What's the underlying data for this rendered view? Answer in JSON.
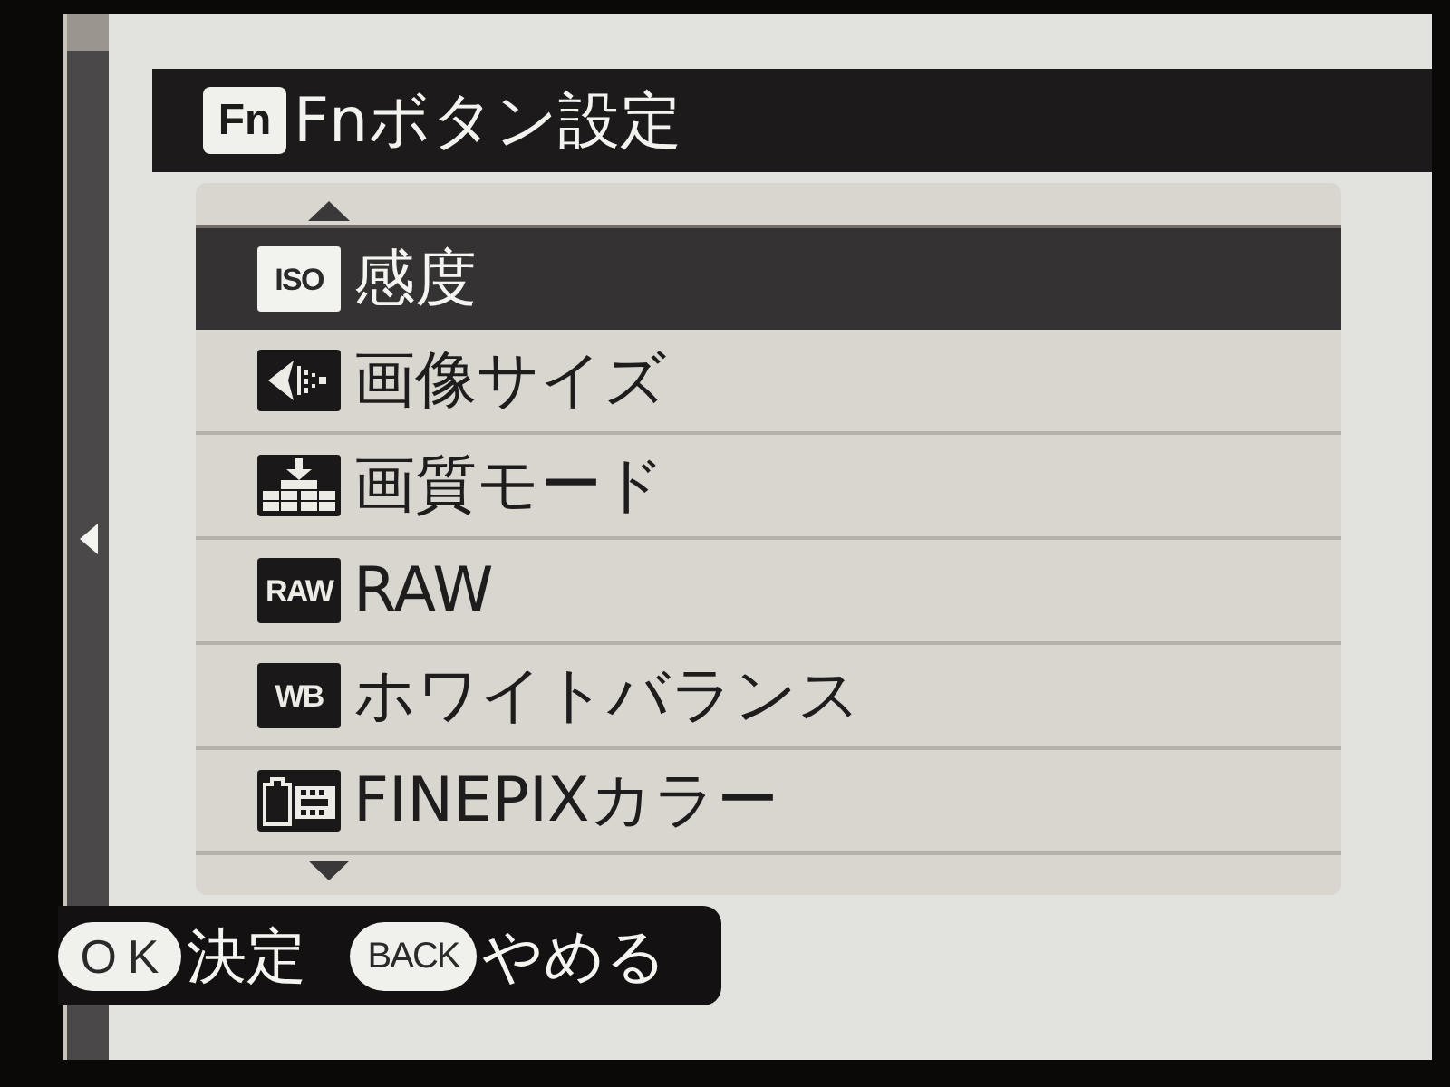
{
  "title": {
    "badge": "Fn",
    "text": "Fnボタン設定"
  },
  "menu": {
    "items": [
      {
        "kind": "badge",
        "badge": "ISO",
        "label": "感度",
        "selected": true
      },
      {
        "kind": "image_size",
        "label": "画像サイズ",
        "selected": false
      },
      {
        "kind": "quality",
        "label": "画質モード",
        "selected": false
      },
      {
        "kind": "badge",
        "badge": "RAW",
        "label": "RAW",
        "selected": false
      },
      {
        "kind": "badge",
        "badge": "WB",
        "label": "ホワイトバランス",
        "selected": false
      },
      {
        "kind": "film",
        "label": "FINEPIXカラー",
        "selected": false
      }
    ]
  },
  "hints": [
    {
      "key": "OK",
      "label": "決定"
    },
    {
      "key": "BACK",
      "label": "やめる"
    }
  ]
}
